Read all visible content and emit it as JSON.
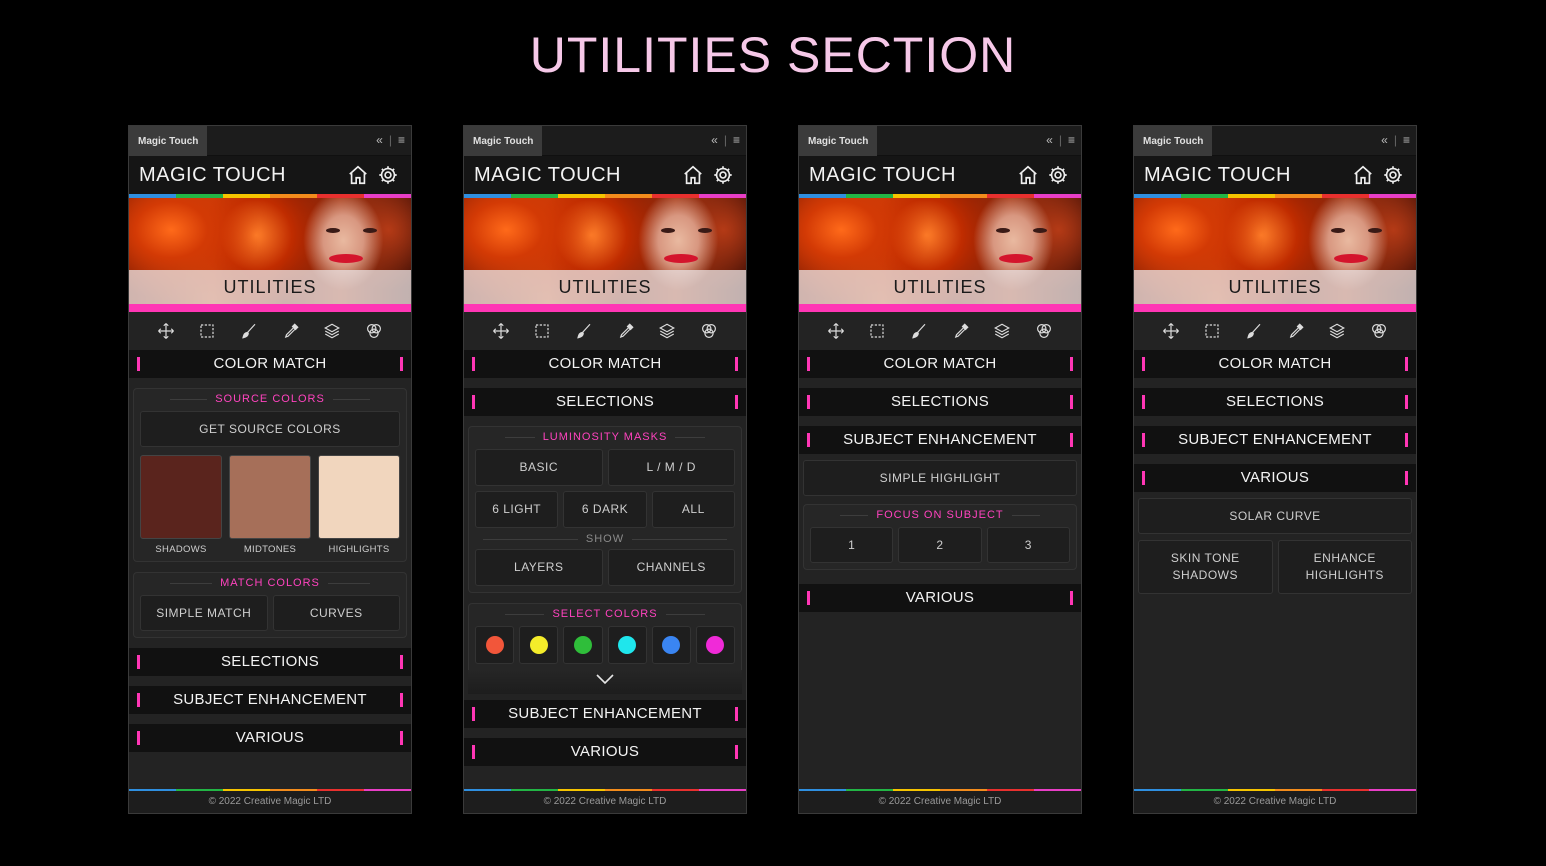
{
  "page": {
    "title": "UTILITIES SECTION"
  },
  "common": {
    "tab_label": "Magic Touch",
    "collapse_glyph": "«",
    "menu_glyph": "≡",
    "app_title": "MAGIC TOUCH",
    "banner_label": "UTILITIES",
    "footer": "© 2022 Creative Magic LTD",
    "rainbow_colors": [
      "#2f8fe0",
      "#22b545",
      "#f5c400",
      "#f38c1c",
      "#e8302e",
      "#e83ec6"
    ],
    "tools": [
      "move-icon",
      "marquee-icon",
      "brush-icon",
      "eyedropper-icon",
      "layers-icon",
      "channels-icon"
    ]
  },
  "panel1": {
    "color_match": "COLOR MATCH",
    "source_colors_title": "SOURCE COLORS",
    "get_source_colors": "GET SOURCE COLORS",
    "swatches": [
      {
        "label": "SHADOWS",
        "color": "#5a241d"
      },
      {
        "label": "MIDTONES",
        "color": "#a66f59"
      },
      {
        "label": "HIGHLIGHTS",
        "color": "#f1d6be"
      }
    ],
    "match_colors_title": "MATCH COLORS",
    "simple_match": "SIMPLE MATCH",
    "curves": "CURVES",
    "selections": "SELECTIONS",
    "subject_enhancement": "SUBJECT ENHANCEMENT",
    "various": "VARIOUS"
  },
  "panel2": {
    "color_match": "COLOR MATCH",
    "selections": "SELECTIONS",
    "luminosity_masks_title": "LUMINOSITY MASKS",
    "basic": "BASIC",
    "lmd": "L / M / D",
    "six_light": "6 LIGHT",
    "six_dark": "6 DARK",
    "all": "ALL",
    "show_label": "SHOW",
    "layers": "LAYERS",
    "channels": "CHANNELS",
    "select_colors_title": "SELECT COLORS",
    "dot_colors": [
      "#f2563a",
      "#f4ec2a",
      "#2fbe3a",
      "#1fe6ec",
      "#3a85f2",
      "#f02ad8"
    ],
    "subject_enhancement": "SUBJECT ENHANCEMENT",
    "various": "VARIOUS"
  },
  "panel3": {
    "color_match": "COLOR MATCH",
    "selections": "SELECTIONS",
    "subject_enhancement": "SUBJECT ENHANCEMENT",
    "simple_highlight": "SIMPLE HIGHLIGHT",
    "focus_title": "FOCUS ON SUBJECT",
    "focus_buttons": [
      "1",
      "2",
      "3"
    ],
    "various": "VARIOUS"
  },
  "panel4": {
    "color_match": "COLOR MATCH",
    "selections": "SELECTIONS",
    "subject_enhancement": "SUBJECT ENHANCEMENT",
    "various": "VARIOUS",
    "solar_curve": "SOLAR CURVE",
    "skin_tone_shadows_line1": "SKIN TONE",
    "skin_tone_shadows_line2": "SHADOWS",
    "enhance_highlights_line1": "ENHANCE",
    "enhance_highlights_line2": "HIGHLIGHTS"
  }
}
